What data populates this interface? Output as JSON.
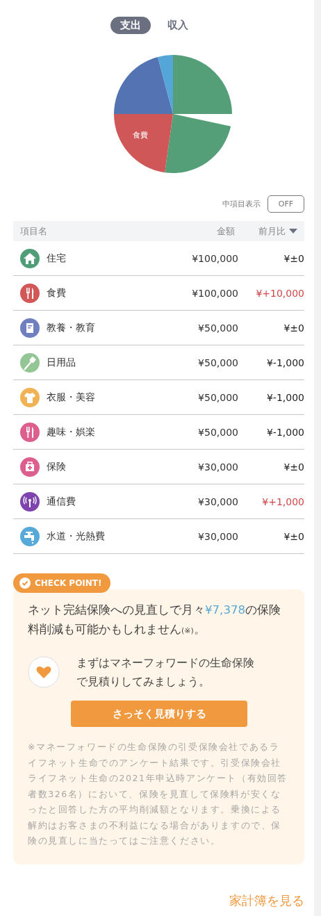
{
  "tabs": [
    {
      "label": "支出",
      "selected": true
    },
    {
      "label": "収入",
      "selected": false
    }
  ],
  "pie": {
    "slice_labels": [
      "食費"
    ]
  },
  "toggle": {
    "label": "中項目表示",
    "state_label": "OFF",
    "on": false
  },
  "table": {
    "columns": [
      "項目名",
      "金額",
      "前月比"
    ],
    "rows": [
      {
        "name": "住宅",
        "amount": "¥100,000",
        "change": "¥±0",
        "increase": false,
        "color": "#4f9e78"
      },
      {
        "name": "食費",
        "amount": "¥100,000",
        "change": "¥+10,000",
        "increase": true,
        "color": "#d25757"
      },
      {
        "name": "教養・教育",
        "amount": "¥50,000",
        "change": "¥±0",
        "increase": false,
        "color": "#6f7fc0"
      },
      {
        "name": "日用品",
        "amount": "¥50,000",
        "change": "¥-1,000",
        "increase": false,
        "color": "#94c595"
      },
      {
        "name": "衣服・美容",
        "amount": "¥50,000",
        "change": "¥-1,000",
        "increase": false,
        "color": "#f0b254"
      },
      {
        "name": "趣味・娯楽",
        "amount": "¥50,000",
        "change": "¥-1,000",
        "increase": false,
        "color": "#dc5f8e"
      },
      {
        "name": "保険",
        "amount": "¥30,000",
        "change": "¥±0",
        "increase": false,
        "color": "#dc5f8e"
      },
      {
        "name": "通信費",
        "amount": "¥30,000",
        "change": "¥+1,000",
        "increase": true,
        "color": "#7f43ae"
      },
      {
        "name": "水道・光熱費",
        "amount": "¥30,000",
        "change": "¥±0",
        "increase": false,
        "color": "#56a9d8"
      }
    ]
  },
  "checkpoint": {
    "badge": "CHECK POINT!",
    "message": {
      "before": "ネット完結保険への見直しで月々",
      "amount": "¥7,378",
      "after": "の保険料削減も可能かもしれません",
      "mark": "(※)",
      "end": "。"
    },
    "suggestion": "まずはマネーフォワードの生命保険で見積りしてみましょう。",
    "button": "さっそく見積りする",
    "note": "※マネーフォワードの生命保険の引受保険会社であるライフネット生命でのアンケート結果です。引受保険会社ライフネット生命の2021年申込時アンケート（有効回答者数326名）において、保険を見直して保険料が安くなったと回答した方の平均削減額となります。乗換による解約はお客さまの不利益になる場合がありますので、保険の見直しに当たってはご注意ください。"
  },
  "footer_link": "家計簿を見る"
}
